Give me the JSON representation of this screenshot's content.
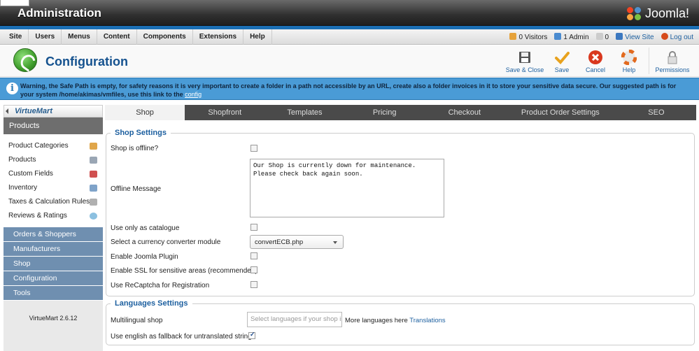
{
  "header": {
    "title": "Administration",
    "brand": "Joomla!"
  },
  "menu": {
    "items": [
      "Site",
      "Users",
      "Menus",
      "Content",
      "Components",
      "Extensions",
      "Help"
    ]
  },
  "status": {
    "visitors": "0 Visitors",
    "admins": "1 Admin",
    "messages": "0",
    "view_site": "View Site",
    "logout": "Log out"
  },
  "toolbar": {
    "title": "Configuration",
    "save_close": "Save & Close",
    "save": "Save",
    "cancel": "Cancel",
    "help": "Help",
    "permissions": "Permissions"
  },
  "warning": {
    "text": "Warning, the Safe Path is empty, for safety reasons it is very important to create a folder in a path not accessible by an URL, create also a folder invoices in it to store your sensitive data secure. Our suggested path is for your system /home/akimas/vmfiles, use this link to the",
    "link": "config"
  },
  "sidebar": {
    "logo": "VirtueMart",
    "active_section": "Products",
    "sub_items": [
      {
        "label": "Product Categories",
        "color": "#e0a64a"
      },
      {
        "label": "Products",
        "color": "#9aa6b4"
      },
      {
        "label": "Custom Fields",
        "color": "#d05050"
      },
      {
        "label": "Inventory",
        "color": "#7fa3c9"
      },
      {
        "label": "Taxes & Calculation Rules",
        "color": "#b0b0b0"
      },
      {
        "label": "Reviews & Ratings",
        "color": "#8cc0e0"
      }
    ],
    "sections": [
      "Orders & Shoppers",
      "Manufacturers",
      "Shop",
      "Configuration",
      "Tools"
    ],
    "version": "VirtueMart 2.6.12"
  },
  "tabs": [
    "Shop",
    "Shopfront",
    "Templates",
    "Pricing",
    "Checkout",
    "Product Order Settings",
    "SEO"
  ],
  "active_tab": "Shop",
  "shop_settings": {
    "legend": "Shop Settings",
    "offline_label": "Shop is offline?",
    "offline_message_label": "Offline Message",
    "offline_message": "Our Shop is currently down for maintenance. Please check back again soon.",
    "catalogue_label": "Use only as catalogue",
    "currency_label": "Select a currency converter module",
    "currency_value": "convertECB.php",
    "joomla_plugin_label": "Enable Joomla Plugin",
    "ssl_label": "Enable SSL for sensitive areas (recommended)",
    "recaptcha_label": "Use ReCaptcha for Registration"
  },
  "languages_settings": {
    "legend": "Languages Settings",
    "multilingual_label": "Multilingual shop",
    "multilingual_placeholder": "Select languages if your shop is",
    "more_text": "More languages here",
    "more_link": "Translations",
    "fallback_label": "Use english as fallback for untranslated strings"
  }
}
